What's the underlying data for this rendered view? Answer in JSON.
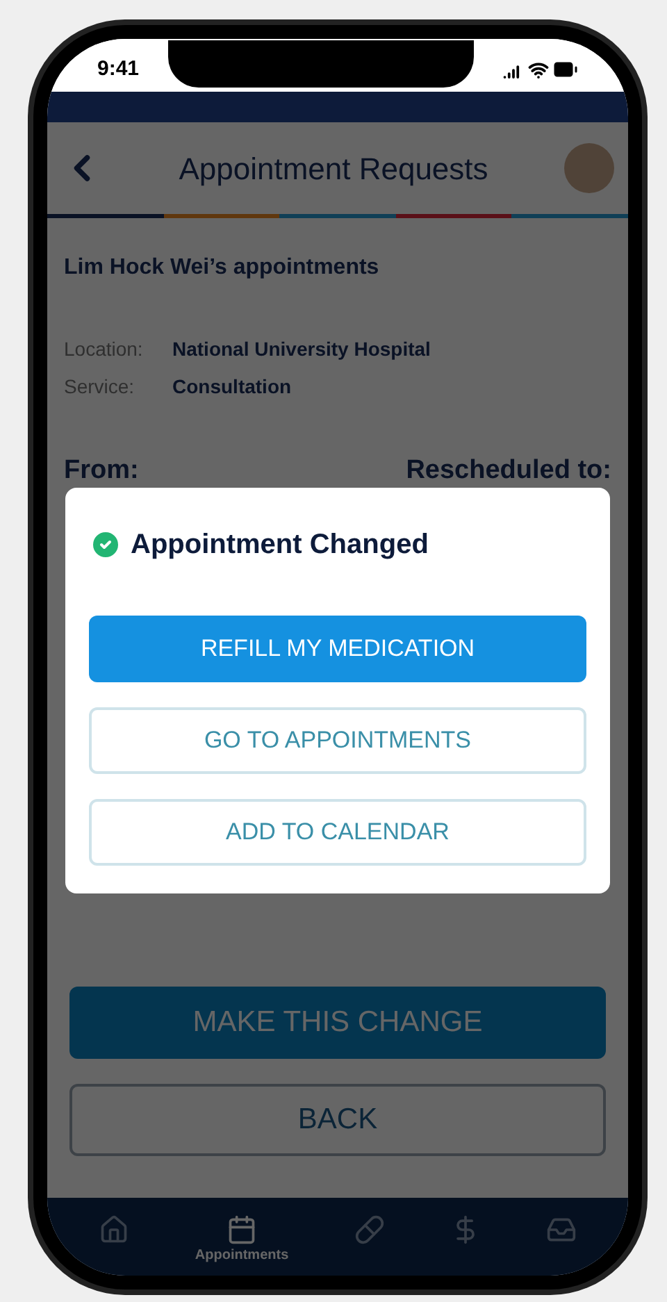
{
  "status_bar": {
    "time": "9:41"
  },
  "header": {
    "title": "Appointment Requests"
  },
  "patient": {
    "heading": "Lim Hock Wei’s appointments"
  },
  "details": [
    {
      "label": "Location:",
      "value": "National University Hospital"
    },
    {
      "label": "Service:",
      "value": "Consultation"
    }
  ],
  "columns": {
    "from": "From:",
    "to": "Rescheduled to:"
  },
  "actions": [
    {
      "label": "MAKE THIS CHANGE",
      "kind": "primary"
    },
    {
      "label": "BACK",
      "kind": "outline"
    }
  ],
  "dialog": {
    "title": "Appointment Changed",
    "buttons": [
      {
        "label": "REFILL MY MEDICATION",
        "kind": "primary"
      },
      {
        "label": "GO TO APPOINTMENTS",
        "kind": "outline"
      },
      {
        "label": "ADD TO CALENDAR",
        "kind": "outline"
      }
    ]
  },
  "tab_bar": [
    {
      "selected": false
    },
    {
      "label": "Appointments",
      "selected": true
    },
    {
      "selected": false
    },
    {
      "selected": false
    },
    {
      "selected": false
    }
  ]
}
